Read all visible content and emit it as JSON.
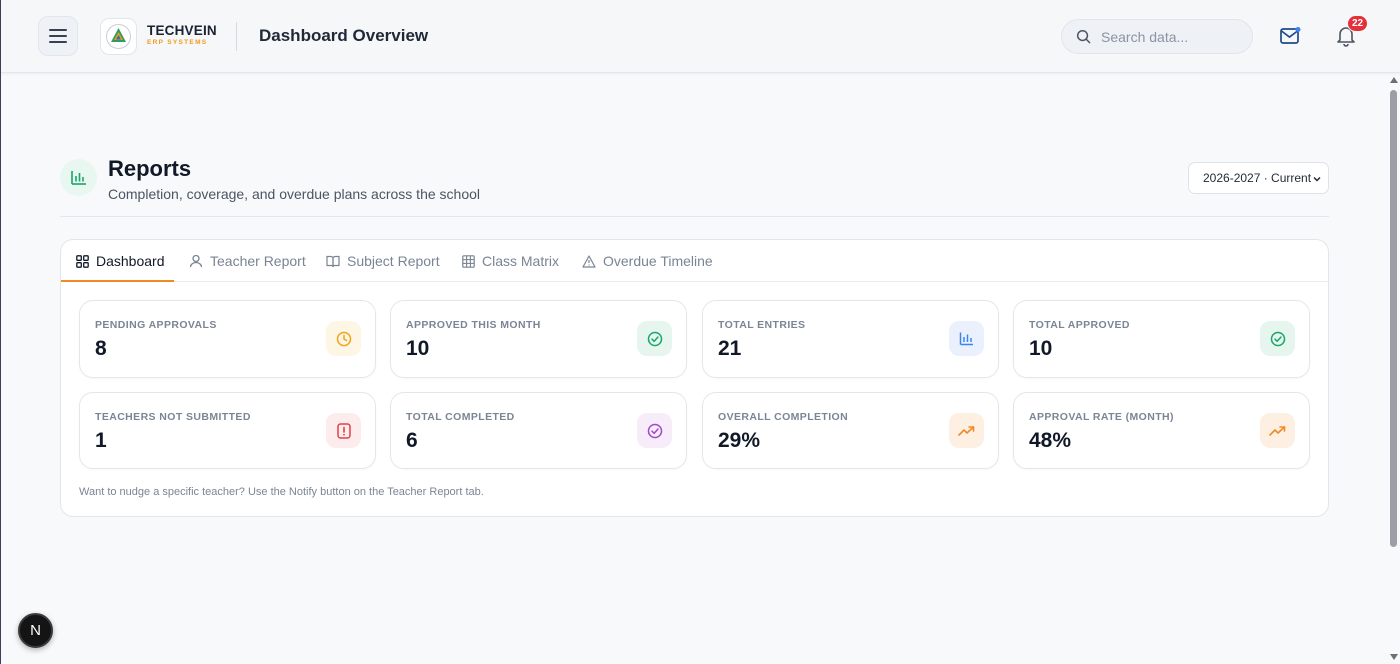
{
  "header": {
    "brand_name": "TECHVEIN",
    "brand_sub": "ERP SYSTEMS",
    "page_title": "Dashboard Overview",
    "search_placeholder": "Search data...",
    "notification_count": "22"
  },
  "reports": {
    "title": "Reports",
    "subtitle": "Completion, coverage, and overdue plans across the school",
    "year_selected": "2026-2027 · Current"
  },
  "tabs": [
    {
      "label": "Dashboard",
      "icon": "grid-icon",
      "active": true
    },
    {
      "label": "Teacher Report",
      "icon": "user-icon",
      "active": false
    },
    {
      "label": "Subject Report",
      "icon": "book-icon",
      "active": false
    },
    {
      "label": "Class Matrix",
      "icon": "table-icon",
      "active": false
    },
    {
      "label": "Overdue Timeline",
      "icon": "warning-icon",
      "active": false
    }
  ],
  "stats": [
    {
      "label": "PENDING APPROVALS",
      "value": "8",
      "icon": "clock-icon",
      "color": "#f0a21a",
      "bg": "#fef6e4"
    },
    {
      "label": "APPROVED THIS MONTH",
      "value": "10",
      "icon": "check-circle-icon",
      "color": "#1aa56b",
      "bg": "#e6f6ee"
    },
    {
      "label": "TOTAL ENTRIES",
      "value": "21",
      "icon": "bar-chart-icon",
      "color": "#3b82f6",
      "bg": "#eaf1fd"
    },
    {
      "label": "TOTAL APPROVED",
      "value": "10",
      "icon": "check-circle-icon",
      "color": "#1aa56b",
      "bg": "#e6f6ee"
    },
    {
      "label": "TEACHERS NOT SUBMITTED",
      "value": "1",
      "icon": "alert-icon",
      "color": "#e0404a",
      "bg": "#fdecec"
    },
    {
      "label": "TOTAL COMPLETED",
      "value": "6",
      "icon": "check-circle-icon",
      "color": "#a347c9",
      "bg": "#f6ecfa"
    },
    {
      "label": "OVERALL COMPLETION",
      "value": "29%",
      "icon": "trending-up-icon",
      "color": "#f08a24",
      "bg": "#fdf0e3"
    },
    {
      "label": "APPROVAL RATE (MONTH)",
      "value": "48%",
      "icon": "trending-up-icon",
      "color": "#f08a24",
      "bg": "#fdf0e3"
    }
  ],
  "hint": "Want to nudge a specific teacher? Use the Notify button on the Teacher Report tab.",
  "dev_badge": "N"
}
